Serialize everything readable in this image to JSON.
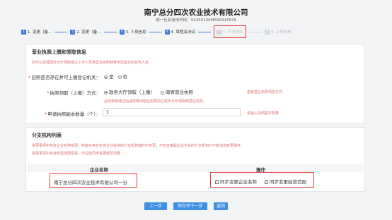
{
  "header": {
    "company_name": "南宁总分四次农业技术有限公司",
    "credit_code": "统一社会信用代码：91450100MA5K91F878"
  },
  "steps": [
    {
      "num": "1",
      "label": "1. 变更（备..."
    },
    {
      "num": "2",
      "label": "2. 变更（备..."
    },
    {
      "num": "3",
      "label": "3. 人员信息"
    },
    {
      "num": "4",
      "label": "4. 章程及决议"
    },
    {
      "num": "5",
      "label": "5. 补充信息"
    },
    {
      "num": "6",
      "label": "6. 上传材料"
    }
  ],
  "license_section": {
    "title": "营业执照上缴和领取信息",
    "notice": "您可以选择国务大厅领取或以工作人员将营业执照邮寄到您指定的收件人处",
    "q1_label": "旧照是否存在并可上缴登记机关：",
    "q1_options": [
      "是",
      "否"
    ],
    "q2_label": "执照领取（上缴）方式：",
    "q2_options": [
      "政务大厅领取（上缴）",
      "邮寄营业执照"
    ],
    "q2_link": "查看营业执照领取方式",
    "q2_note": "业务审核通过后请携带旧营业执照前往政务大厅领取新营业执照。",
    "q3_label": "申请执照副本数量（个）：",
    "q3_value": "1",
    "q3_link": "请输入执照副本数量"
  },
  "branch_section": {
    "title": "分支机构列表",
    "notice1": "变更事项中包含企业名称变更，并能在存在包含企业名称的分支机构或时不变更，不包含隶属企业全名的分支机构时不能勾选变更操作",
    "notice2": "变更事项中包含经营范围变更，可勾选同步变更经营范围",
    "col_company": "企业名称",
    "col_action": "操作",
    "rows": [
      {
        "company": "南宁总分四次农业技术有限公司一分",
        "sync_name": "同步变更企业名称",
        "sync_scope": "同步变更经营范围"
      }
    ]
  },
  "buttons": {
    "prev": "上一步",
    "save_next": "保存并下一步",
    "back": "返回"
  }
}
